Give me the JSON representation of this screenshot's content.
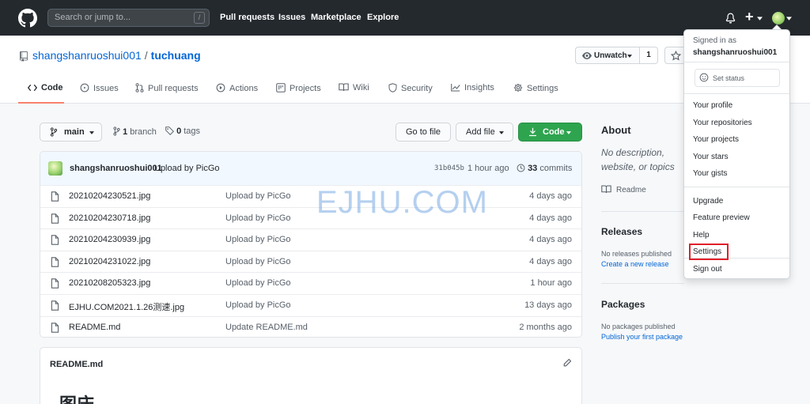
{
  "header": {
    "search_placeholder": "Search or jump to...",
    "search_shortcut": "/",
    "nav": [
      "Pull requests",
      "Issues",
      "Marketplace",
      "Explore"
    ],
    "plus_label": "+"
  },
  "repo": {
    "owner": "shangshanruoshui001",
    "separator": "/",
    "name": "tuchuang",
    "watch_label": "Unwatch",
    "watch_count": "1"
  },
  "tabs": [
    {
      "label": "Code",
      "icon": "code-icon"
    },
    {
      "label": "Issues",
      "icon": "issue-icon"
    },
    {
      "label": "Pull requests",
      "icon": "pull-request-icon"
    },
    {
      "label": "Actions",
      "icon": "play-icon"
    },
    {
      "label": "Projects",
      "icon": "project-icon"
    },
    {
      "label": "Wiki",
      "icon": "book-icon"
    },
    {
      "label": "Security",
      "icon": "shield-icon"
    },
    {
      "label": "Insights",
      "icon": "graph-icon"
    },
    {
      "label": "Settings",
      "icon": "gear-icon"
    }
  ],
  "toolbar": {
    "branch_button": "main",
    "branch_count": "1",
    "branch_word": "branch",
    "tags_count": "0",
    "tags_word": "tags",
    "goto_file": "Go to file",
    "add_file": "Add file",
    "code_button": "Code"
  },
  "commit": {
    "author": "shangshanruoshui001",
    "message": "Upload by PicGo",
    "sha": "31b045b",
    "time": "1 hour ago",
    "count": "33",
    "count_word": "commits"
  },
  "files": [
    {
      "name": "20210204230521.jpg",
      "commit": "Upload by PicGo",
      "age": "4 days ago"
    },
    {
      "name": "20210204230718.jpg",
      "commit": "Upload by PicGo",
      "age": "4 days ago"
    },
    {
      "name": "20210204230939.jpg",
      "commit": "Upload by PicGo",
      "age": "4 days ago"
    },
    {
      "name": "20210204231022.jpg",
      "commit": "Upload by PicGo",
      "age": "4 days ago"
    },
    {
      "name": "20210208205323.jpg",
      "commit": "Upload by PicGo",
      "age": "1 hour ago"
    },
    {
      "name": "EJHU.COM2021.1.26测速.jpg",
      "commit": "Upload by PicGo",
      "age": "13 days ago"
    },
    {
      "name": "README.md",
      "commit": "Update README.md",
      "age": "2 months ago"
    }
  ],
  "readme": {
    "header": "README.md",
    "heading": "图床"
  },
  "sidebar": {
    "about_title": "About",
    "about_desc": "No description, website, or topics provided.",
    "readme_link": "Readme",
    "releases_title": "Releases",
    "releases_none": "No releases published",
    "releases_create": "Create a new release",
    "packages_title": "Packages",
    "packages_none": "No packages published",
    "packages_publish": "Publish your first package"
  },
  "watermark": "EJHU.COM",
  "dropdown": {
    "signed_in_as": "Signed in as",
    "username": "shangshanruoshui001",
    "set_status": "Set status",
    "group1": [
      "Your profile",
      "Your repositories",
      "Your projects",
      "Your stars",
      "Your gists"
    ],
    "group2": [
      "Upgrade",
      "Feature preview",
      "Help",
      "Settings"
    ],
    "sign_out": "Sign out",
    "highlighted": "Settings"
  },
  "colors": {
    "header_bg": "#24292e",
    "link": "#0366d6",
    "green": "#2ea44f",
    "tab_underline": "#f9826c",
    "highlight_box": "#e0202a"
  }
}
